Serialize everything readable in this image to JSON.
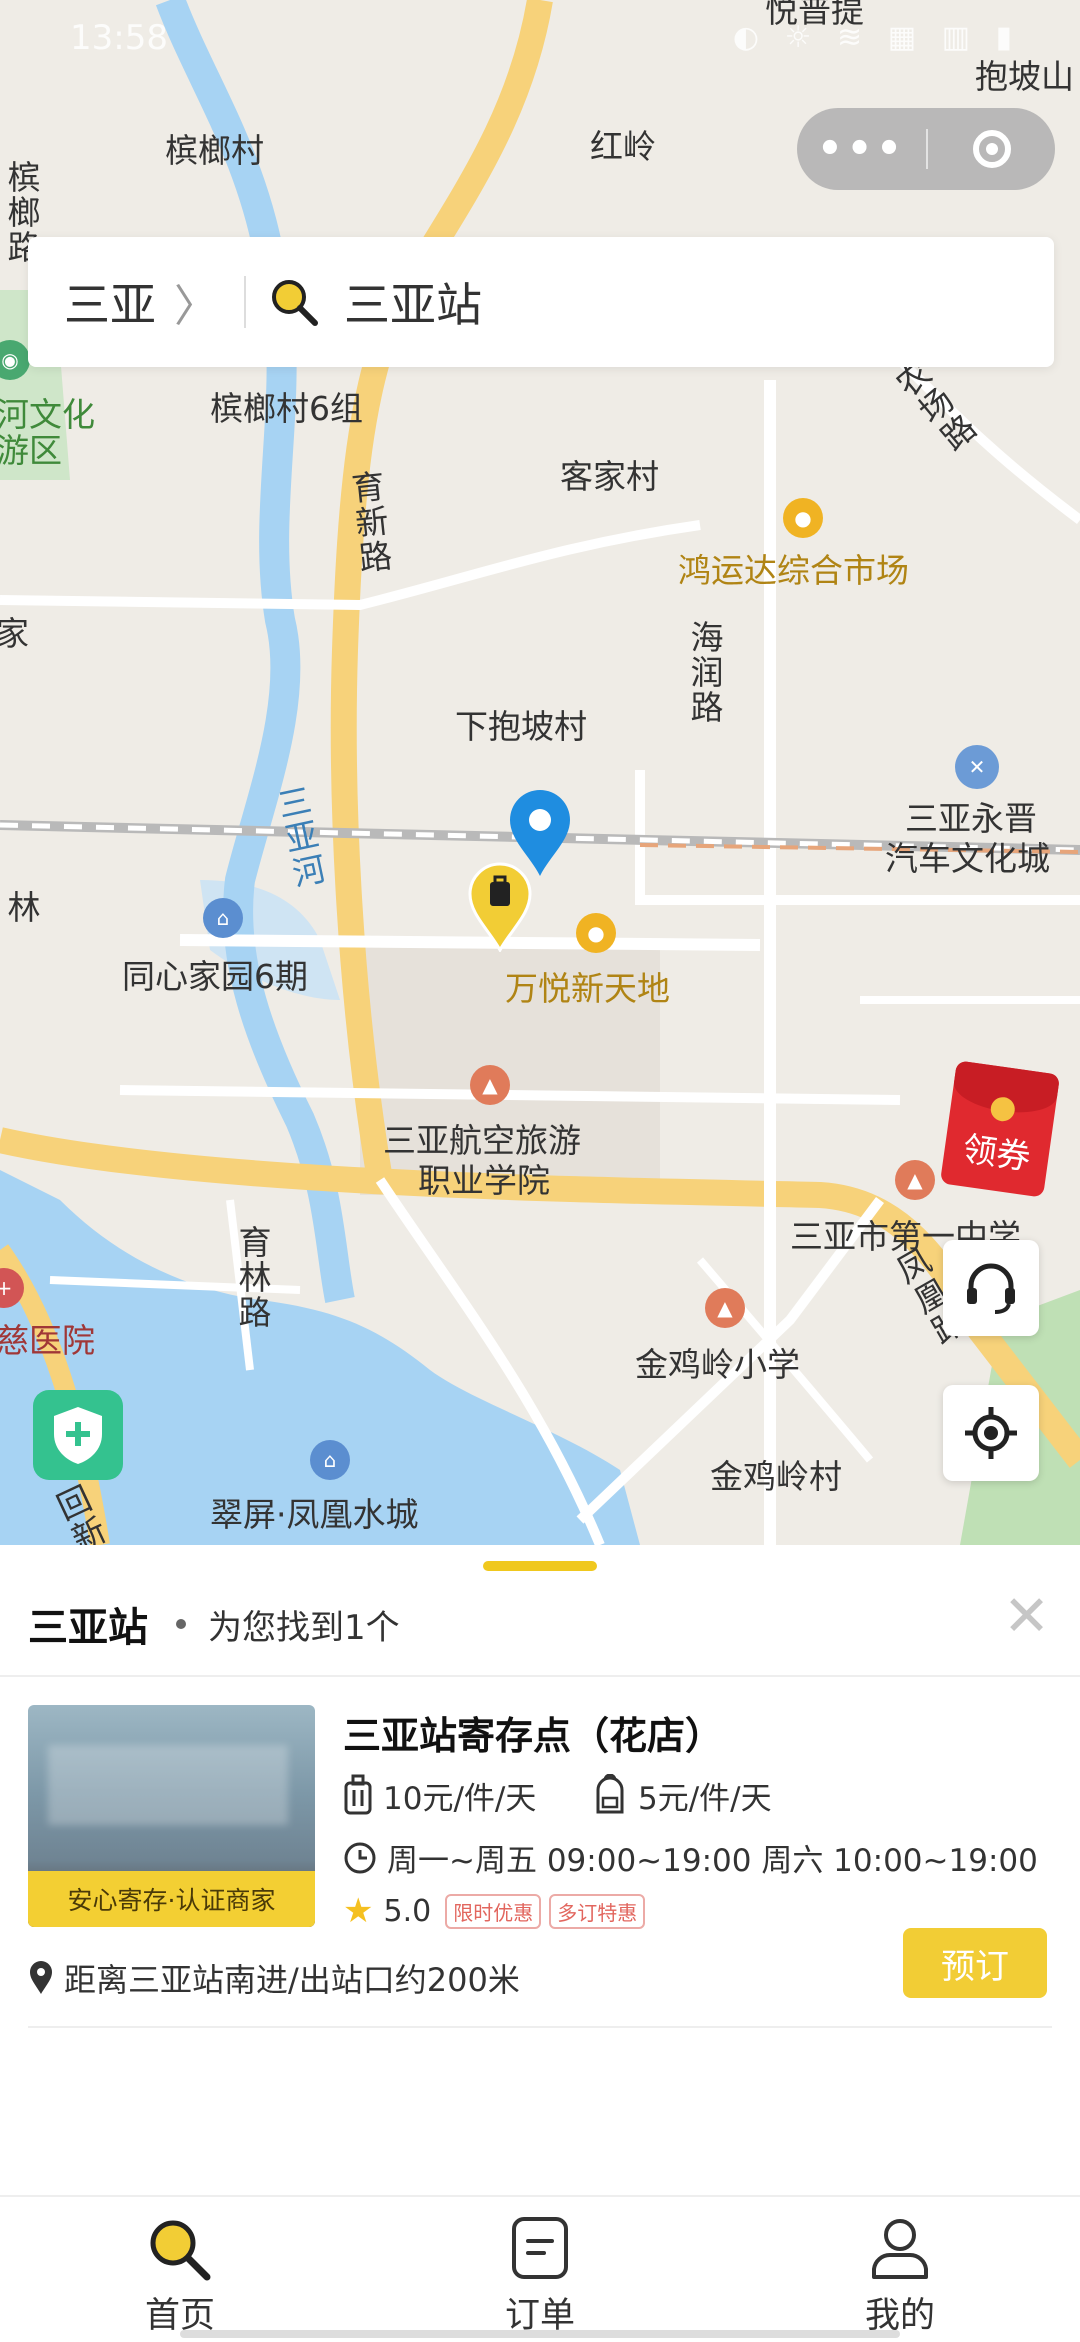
{
  "status_bar": {
    "time": "13:58",
    "icons": "◐ ☼ ≋ ▦ ▥ ▮"
  },
  "capsule": {
    "more_glyph": "•••"
  },
  "search": {
    "city": "三亚",
    "chevron": "〉",
    "query": "三亚站"
  },
  "map": {
    "labels": [
      "悦普提",
      "抱坡山",
      "槟榔村",
      "红岭",
      "槟榔村6组",
      "客家村",
      "鸿运达综合市场",
      "海润路",
      "下抱坡村",
      "三亚永晋",
      "汽车文化城",
      "同心家园6期",
      "万悦新天地",
      "三亚航空旅游",
      "职业学院",
      "三亚市第一中学",
      "金鸡岭小学",
      "金鸡岭村",
      "翠屏·凤凰水城",
      "育新路",
      "三亚河",
      "育林路",
      "凤凰路",
      "槟榔路",
      "河文化",
      "游区",
      "家",
      "慈医院",
      "回新",
      "林",
      "农场路"
    ]
  },
  "coupon": {
    "label": "领券"
  },
  "results": {
    "station": "三亚站",
    "found_text": "为您找到1个",
    "close": "✕",
    "store": {
      "name": "三亚站寄存点（花店）",
      "badge": "安心寄存·认证商家",
      "price_luggage": "10元/件/天",
      "price_bag": "5元/件/天",
      "hours": "周一~周五 09:00~19:00 周六 10:00~19:00",
      "rating": "5.0",
      "tags": [
        "限时优惠",
        "多订特惠"
      ],
      "distance": "距离三亚站南进/出站口约200米",
      "book_label": "预订"
    }
  },
  "tabbar": {
    "home": "首页",
    "orders": "订单",
    "mine": "我的"
  },
  "colors": {
    "accent": "#f2cd35",
    "river": "#a7d3f3",
    "road": "#f7d27a",
    "pin_blue": "#1f8de0"
  }
}
